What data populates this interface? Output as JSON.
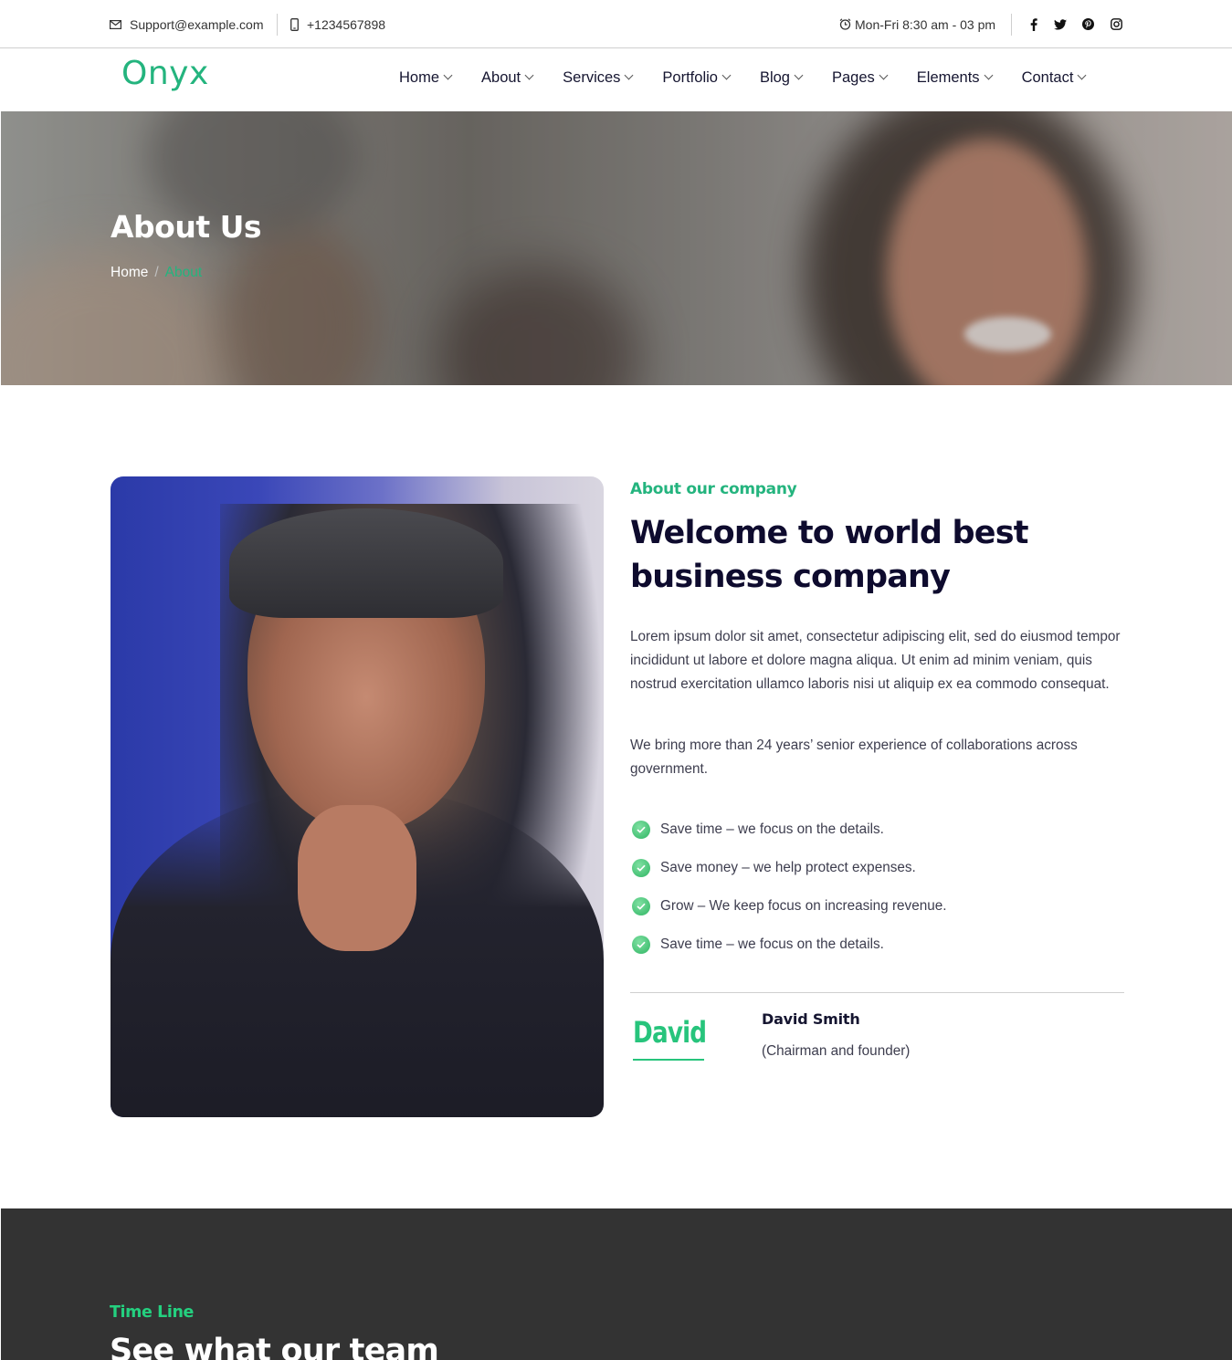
{
  "topbar": {
    "email": "Support@example.com",
    "phone": "+1234567898",
    "hours": "Mon-Fri 8:30 am - 03 pm",
    "social": [
      {
        "icon": "facebook-icon",
        "glyph": "f"
      },
      {
        "icon": "twitter-icon",
        "glyph": "t"
      },
      {
        "icon": "pinterest-icon",
        "glyph": "p"
      },
      {
        "icon": "instagram-icon",
        "glyph": "i"
      }
    ]
  },
  "brand": {
    "logo": "Onyx",
    "accent_color": "#24b47e",
    "dark_text_color": "#0e0b2e"
  },
  "nav": {
    "items": [
      "Home",
      "About",
      "Services",
      "Portfolio",
      "Blog",
      "Pages",
      "Elements",
      "Contact"
    ]
  },
  "hero": {
    "title": "About Us",
    "breadcrumb": {
      "home": "Home",
      "separator": "/",
      "current": "About"
    }
  },
  "about": {
    "eyebrow": "About our company",
    "headline_line1": "Welcome to world best",
    "headline_line2": "business company",
    "paragraph1": "Lorem ipsum dolor sit amet, consectetur adipiscing elit, sed do eiusmod tempor incididunt ut labore et dolore magna aliqua. Ut enim ad minim veniam, quis nostrud exercitation ullamco laboris nisi ut aliquip ex ea commodo consequat.",
    "paragraph2": "We bring more than 24 years’ senior experience of collaborations across government.",
    "checklist": [
      "Save time – we focus on the details.",
      "Save money – we help protect expenses.",
      "Grow – We keep focus on increasing revenue.",
      "Save time – we focus on the details."
    ],
    "signature": "David",
    "founder_name": "David Smith",
    "founder_role": "(Chairman and founder)"
  },
  "timeline": {
    "eyebrow": "Time Line",
    "heading": "See what our team"
  }
}
